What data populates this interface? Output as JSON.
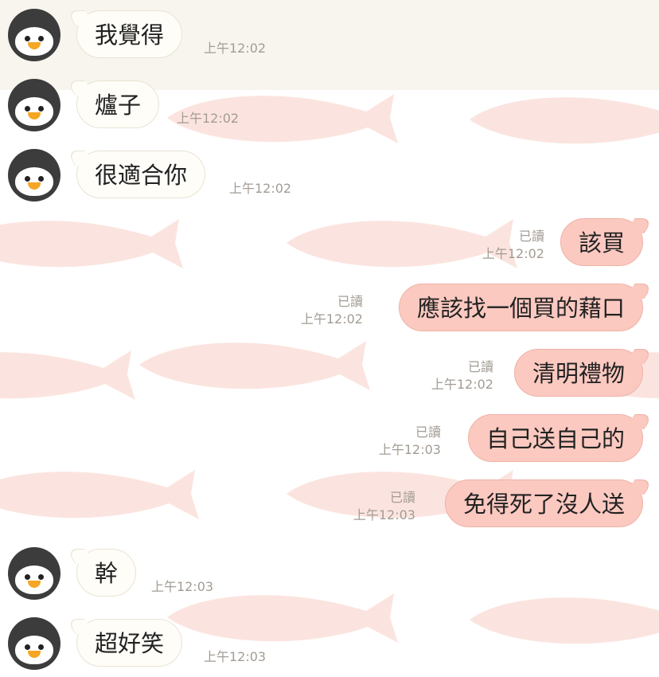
{
  "theme": {
    "outgoing_bubble": "#fbc9c0",
    "incoming_bubble": "#fffdf8",
    "background_fish": "#fbe0da",
    "highlight_row": "#f8f5ee"
  },
  "messages": [
    {
      "direction": "in",
      "text": "我覺得",
      "time": "上午12:02"
    },
    {
      "direction": "in",
      "text": "爐子",
      "time": "上午12:02"
    },
    {
      "direction": "in",
      "text": "很適合你",
      "time": "上午12:02"
    },
    {
      "direction": "out",
      "text": "該買",
      "time": "上午12:02",
      "read": "已讀"
    },
    {
      "direction": "out",
      "text": "應該找一個買的藉口",
      "time": "上午12:02",
      "read": "已讀"
    },
    {
      "direction": "out",
      "text": "清明禮物",
      "time": "上午12:02",
      "read": "已讀"
    },
    {
      "direction": "out",
      "text": "自己送自己的",
      "time": "上午12:03",
      "read": "已讀"
    },
    {
      "direction": "out",
      "text": "免得死了沒人送",
      "time": "上午12:03",
      "read": "已讀"
    },
    {
      "direction": "in",
      "text": "幹",
      "time": "上午12:03"
    },
    {
      "direction": "in",
      "text": "超好笑",
      "time": "上午12:03"
    }
  ]
}
